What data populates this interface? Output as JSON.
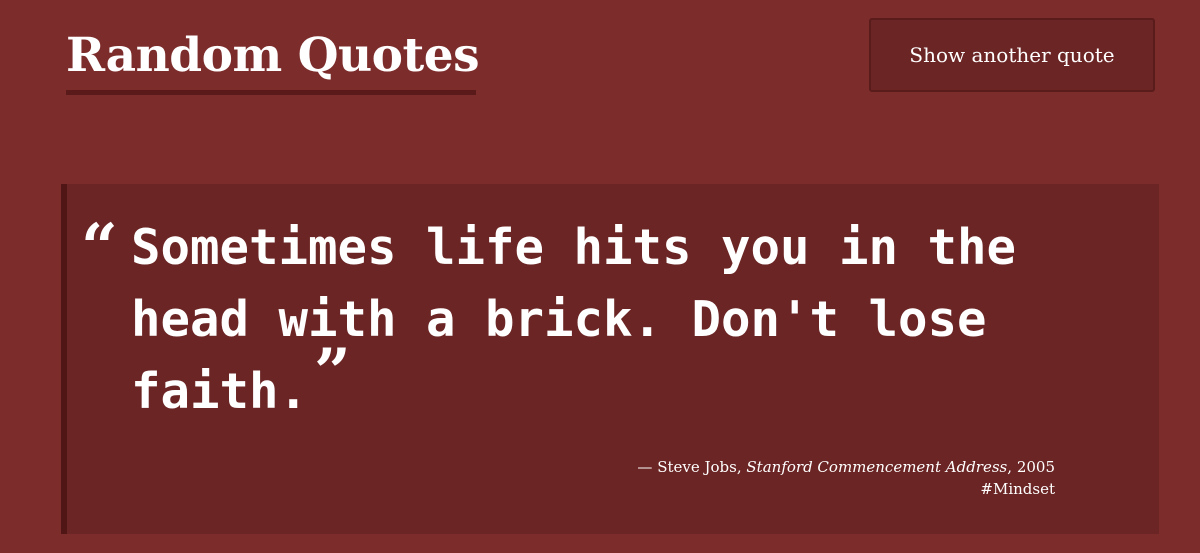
{
  "header": {
    "title": "Random Quotes",
    "button_label": "Show another quote"
  },
  "quote": {
    "open_mark": "“",
    "text": "Sometimes life hits you in the head with a brick. Don't lose faith.",
    "close_mark": "”",
    "dash": "—",
    "author": "Steve Jobs",
    "source": "Stanford Commencement Address",
    "year": "2005",
    "tag": "#Mindset"
  },
  "colors": {
    "background": "#7c2c2b",
    "card": "#6b2524",
    "accent": "#501616",
    "text": "#ffffff"
  }
}
